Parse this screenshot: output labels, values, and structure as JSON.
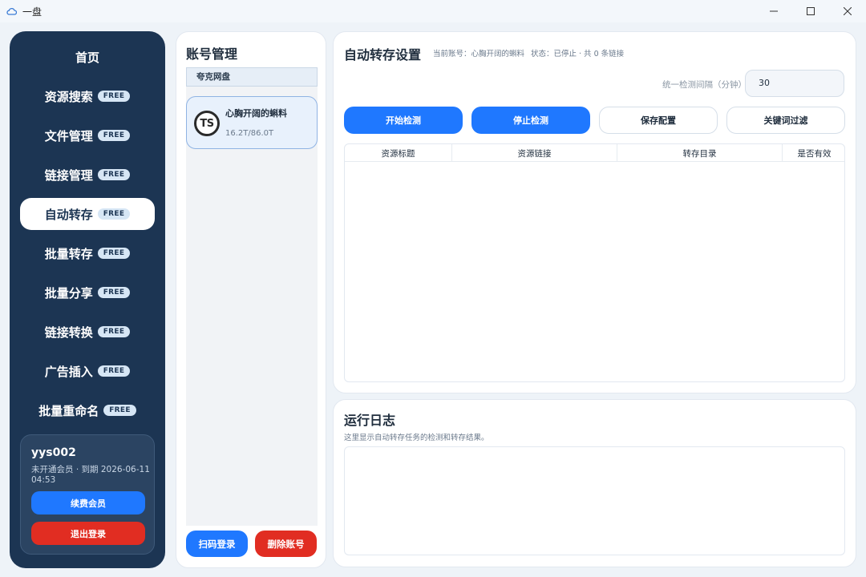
{
  "window": {
    "title": "一盘"
  },
  "sidebar": {
    "items": [
      {
        "label": "首页",
        "badge": ""
      },
      {
        "label": "资源搜索",
        "badge": "FREE"
      },
      {
        "label": "文件管理",
        "badge": "FREE"
      },
      {
        "label": "链接管理",
        "badge": "FREE"
      },
      {
        "label": "自动转存",
        "badge": "FREE",
        "active": true
      },
      {
        "label": "批量转存",
        "badge": "FREE"
      },
      {
        "label": "批量分享",
        "badge": "FREE"
      },
      {
        "label": "链接转换",
        "badge": "FREE"
      },
      {
        "label": "广告插入",
        "badge": "FREE"
      },
      {
        "label": "批量重命名",
        "badge": "FREE"
      }
    ],
    "user": {
      "name": "yys002",
      "status": "未开通会员 · 到期 2026-06-11 04:53",
      "renew_label": "续费会员",
      "logout_label": "退出登录"
    }
  },
  "accounts": {
    "title": "账号管理",
    "tab": "夸克网盘",
    "card": {
      "avatar_text": "TS",
      "name": "心胸开阔的蝌料",
      "quota": "16.2T/86.0T"
    },
    "scan_label": "扫码登录",
    "delete_label": "删除账号"
  },
  "auto": {
    "title": "自动转存设置",
    "current_account": "当前账号：心胸开阔的蝌料",
    "status": "状态：已停止 · 共 0 条链接",
    "interval_label": "统一检测间隔（分钟）",
    "interval_value": "30",
    "buttons": {
      "start": "开始检测",
      "stop": "停止检测",
      "save": "保存配置",
      "filter": "关键词过滤"
    },
    "columns": [
      "资源标题",
      "资源链接",
      "转存目录",
      "是否有效"
    ]
  },
  "log": {
    "title": "运行日志",
    "subtitle": "这里显示自动转存任务的检测和转存结果。"
  },
  "colors": {
    "sidebar_bg": "#1c3553",
    "primary": "#1f78ff",
    "danger": "#e12d22"
  }
}
